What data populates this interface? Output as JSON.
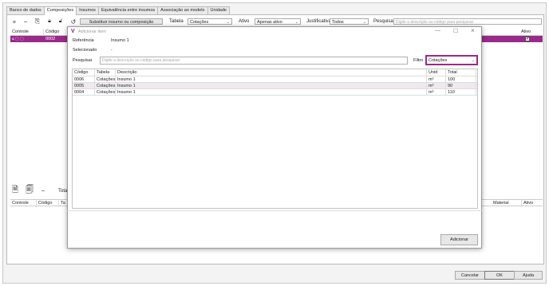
{
  "tabs": [
    {
      "label": "Banco de dados"
    },
    {
      "label": "Composições"
    },
    {
      "label": "Insumos"
    },
    {
      "label": "Equivalência entre insumos"
    },
    {
      "label": "Associação ao modelo"
    },
    {
      "label": "Unidade"
    }
  ],
  "toolbar": {
    "substituir_label": "Substituir insumo ou composição",
    "tabela_label": "Tabela",
    "tabela_value": "Cotações",
    "ativo_label": "Ativo",
    "ativo_value": "Apenas ativo",
    "justificativa_label": "Justificativa",
    "justificativa_value": "Todos",
    "pesquisar_label": "Pesquisar",
    "pesquisar_placeholder": "Digite a descrição ou código para pesquisar"
  },
  "main_table": {
    "col_controle": "Controle",
    "col_codigo": "Código",
    "col_ativo": "Ativo",
    "row_codigo": "0002"
  },
  "lower": {
    "total_label": "Total",
    "col_controle": "Controle",
    "col_codigo": "Código",
    "col_ta": "Ta",
    "col_material": "Material",
    "col_ativo": "Ativo"
  },
  "modal": {
    "title": "Adicionar item",
    "referencia_label": "Referência",
    "referencia_value": "Insumo 1",
    "selecionado_label": "Selecionado",
    "selecionado_value": "-",
    "pesquisar_label": "Pesquisar",
    "pesquisar_placeholder": "Digite a descrição ou código para pesquisar",
    "filtro_label": "Filtro",
    "filtro_value": "Cotações",
    "adicionar_label": "Adicionar",
    "columns": {
      "codigo": "Código",
      "tabela": "Tabela",
      "descricao": "Descrição",
      "unid": "Unid",
      "total": "Total"
    },
    "rows": [
      {
        "codigo": "0006",
        "tabela": "Cotações",
        "descricao": "Insumo 1",
        "unid": "m³",
        "total": "100"
      },
      {
        "codigo": "0005",
        "tabela": "Cotações",
        "descricao": "Insumo 1",
        "unid": "m³",
        "total": "90"
      },
      {
        "codigo": "0004",
        "tabela": "Cotações",
        "descricao": "Insumo 1",
        "unid": "m³",
        "total": "110"
      }
    ]
  },
  "footer": {
    "cancelar": "Cancelar",
    "ok": "OK",
    "ajuda": "Ajuda"
  },
  "colors": {
    "accent": "#9a2a8a",
    "selection": "#9a2a8a"
  }
}
